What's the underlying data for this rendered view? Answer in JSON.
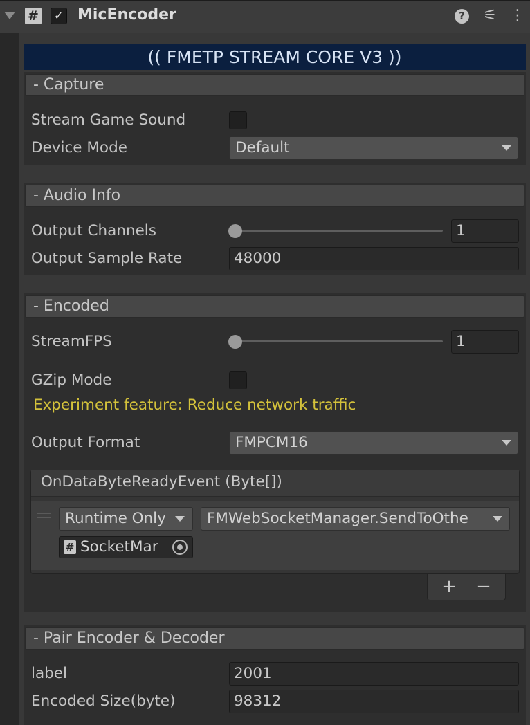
{
  "component": {
    "title": "MicEncoder",
    "script_icon": "#",
    "enabled_check": "✓",
    "icons": [
      "script-icon",
      "help-icon",
      "preset-icon",
      "context-menu-icon"
    ]
  },
  "banner": {
    "text": "(( FMETP STREAM CORE V3 ))"
  },
  "capture": {
    "header": "- Capture",
    "stream_game_sound_label": "Stream Game Sound",
    "stream_game_sound_checked": false,
    "device_mode_label": "Device Mode",
    "device_mode_value": "Default"
  },
  "audio_info": {
    "header": "- Audio Info",
    "output_channels_label": "Output Channels",
    "output_channels_value": "1",
    "output_channels_slider_fraction": 0.0,
    "output_sample_rate_label": "Output Sample Rate",
    "output_sample_rate_value": "48000"
  },
  "encoded": {
    "header": "- Encoded",
    "stream_fps_label": "StreamFPS",
    "stream_fps_value": "1",
    "stream_fps_slider_fraction": 0.0,
    "gzip_label": "GZip Mode",
    "gzip_checked": false,
    "gzip_warning": "Experiment feature: Reduce network traffic",
    "output_format_label": "Output Format",
    "output_format_value": "FMPCM16",
    "event": {
      "header": "OnDataByteReadyEvent (Byte[])",
      "runtime_value": "Runtime Only",
      "function_value": "FMWebSocketManager.SendToOthe",
      "target_object": "SocketMar",
      "add_label": "+",
      "remove_label": "−"
    }
  },
  "pair": {
    "header": "- Pair Encoder & Decoder",
    "label_label": "label",
    "label_value": "2001",
    "encoded_size_label": "Encoded Size(byte)",
    "encoded_size_value": "98312"
  },
  "colors": {
    "banner_bg": "#0b1f3f",
    "warning_text": "#d4c23b",
    "panel_bg": "#383838"
  }
}
